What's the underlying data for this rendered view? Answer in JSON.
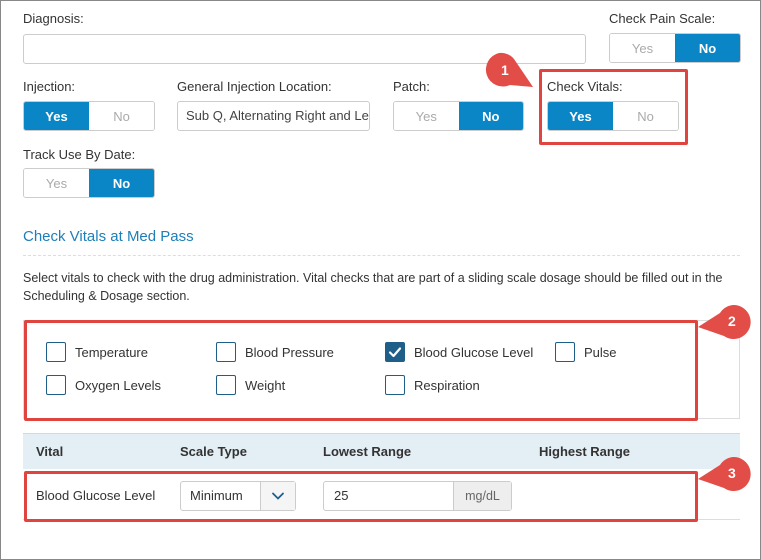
{
  "diagnosis": {
    "label": "Diagnosis:",
    "value": ""
  },
  "check_pain_scale": {
    "label": "Check Pain Scale:",
    "yes": "Yes",
    "no": "No",
    "selected": "No"
  },
  "injection": {
    "label": "Injection:",
    "yes": "Yes",
    "no": "No",
    "selected": "Yes"
  },
  "general_injection_location": {
    "label": "General Injection Location:",
    "value": "Sub Q, Alternating Right and Le"
  },
  "patch": {
    "label": "Patch:",
    "yes": "Yes",
    "no": "No",
    "selected": "No"
  },
  "check_vitals": {
    "label": "Check Vitals:",
    "yes": "Yes",
    "no": "No",
    "selected": "Yes"
  },
  "track_use_by_date": {
    "label": "Track Use By Date:",
    "yes": "Yes",
    "no": "No",
    "selected": "No"
  },
  "section": {
    "title": "Check Vitals at Med Pass",
    "description": "Select vitals to check with the drug administration. Vital checks that are part of a sliding scale dosage should be filled out in the Scheduling & Dosage section."
  },
  "vitals": [
    {
      "label": "Temperature",
      "checked": false
    },
    {
      "label": "Blood Pressure",
      "checked": false
    },
    {
      "label": "Blood Glucose Level",
      "checked": true
    },
    {
      "label": "Pulse",
      "checked": false
    },
    {
      "label": "Oxygen Levels",
      "checked": false
    },
    {
      "label": "Weight",
      "checked": false
    },
    {
      "label": "Respiration",
      "checked": false
    }
  ],
  "table": {
    "headers": [
      "Vital",
      "Scale Type",
      "Lowest Range",
      "Highest Range"
    ],
    "rows": [
      {
        "vital": "Blood Glucose Level",
        "scale_type": "Minimum",
        "lowest_range": "25",
        "unit": "mg/dL"
      }
    ]
  },
  "callouts": [
    "1",
    "2",
    "3"
  ],
  "colors": {
    "accent": "#0a86c6",
    "highlight": "#e0443e",
    "checkbox": "#1e5f8a",
    "section_title": "#1e7fb8"
  }
}
